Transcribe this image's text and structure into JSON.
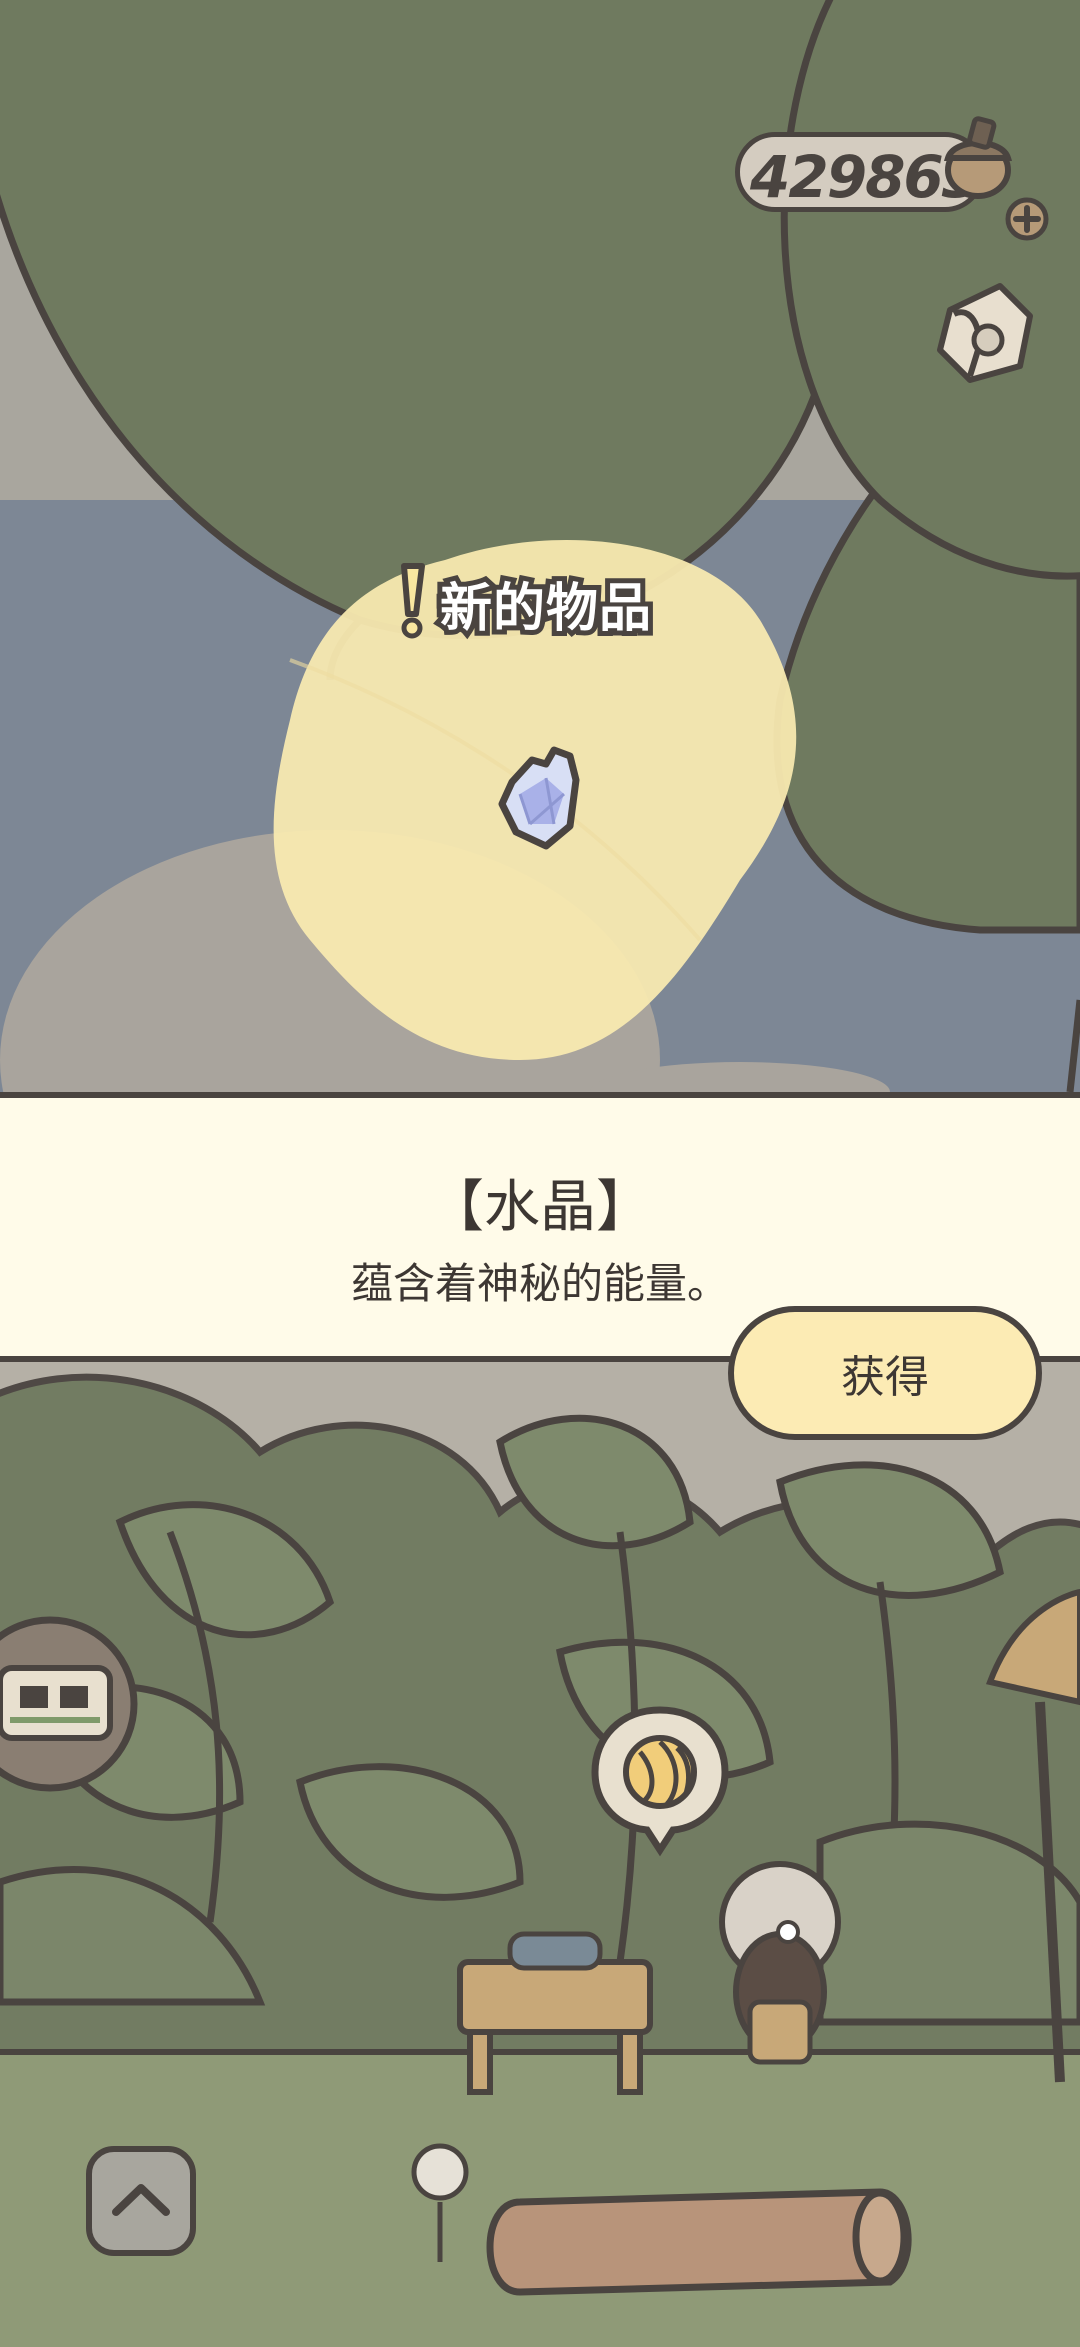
{
  "hud": {
    "acorn_count": "429863",
    "icons": [
      "acorn-icon",
      "plus-icon",
      "letter-icon"
    ]
  },
  "notification": {
    "label": "新的物品",
    "icon": "exclamation-icon"
  },
  "reward": {
    "item_icon": "crystal-icon",
    "name": "【水晶】",
    "description": "蕴含着神秘的能量。",
    "obtain_label": "获得"
  },
  "scene": {
    "icons": [
      "ticket-icon",
      "yarn-icon",
      "chevron-up-icon"
    ]
  },
  "colors": {
    "foliage": "#6f7a5f",
    "sky": "#7d8795",
    "panel": "#fffbe9",
    "button": "#fcebb4",
    "outline": "#4a4440",
    "highlight": "#f9eab0"
  }
}
